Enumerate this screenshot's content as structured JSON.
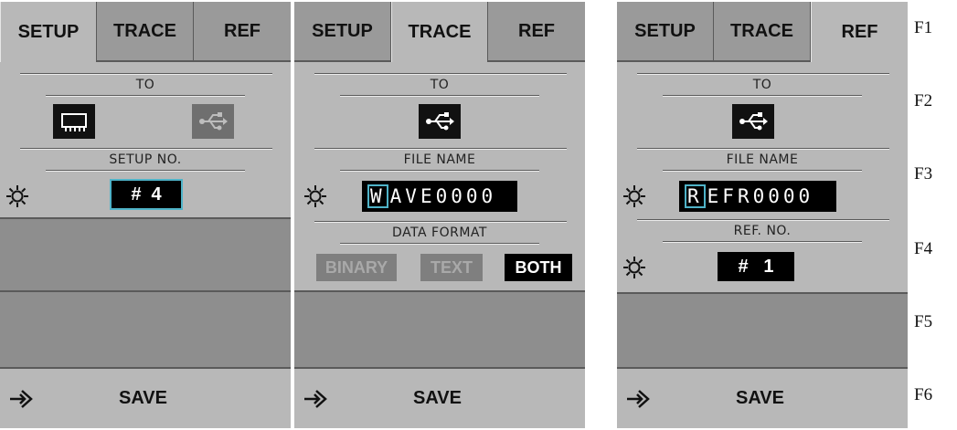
{
  "tabs": {
    "setup": "SETUP",
    "trace": "TRACE",
    "ref": "REF"
  },
  "setup_panel": {
    "active_tab": "setup",
    "to_label": "TO",
    "destinations": [
      "chip-memory-icon",
      "usb-icon"
    ],
    "selected_destination": "internal memory",
    "setup_no_label": "SETUP NO.",
    "setup_no_value": "#  4",
    "action_label": "SAVE"
  },
  "trace_panel": {
    "active_tab": "trace",
    "to_label": "TO",
    "destination_icon": "usb-icon",
    "file_name_label": "FILE NAME",
    "file_name_cursor_char": "W",
    "file_name_rest": "AVE0000",
    "data_format_label": "DATA FORMAT",
    "formats": [
      "BINARY",
      "TEXT",
      "BOTH"
    ],
    "selected_format": "BOTH",
    "action_label": "SAVE"
  },
  "ref_panel": {
    "active_tab": "ref",
    "to_label": "TO",
    "destination_icon": "usb-icon",
    "file_name_label": "FILE NAME",
    "file_name_cursor_char": "R",
    "file_name_rest": "EFR0000",
    "ref_no_label": "REF. NO.",
    "ref_no_value": "#   1",
    "action_label": "SAVE"
  },
  "function_keys": [
    "F1",
    "F2",
    "F3",
    "F4",
    "F5",
    "F6"
  ],
  "colors": {
    "panel": "#b8b8b8",
    "inactive_tab": "#9a9a9a",
    "empty_slot": "#8e8e8e",
    "highlight": "#4fb3c8"
  }
}
